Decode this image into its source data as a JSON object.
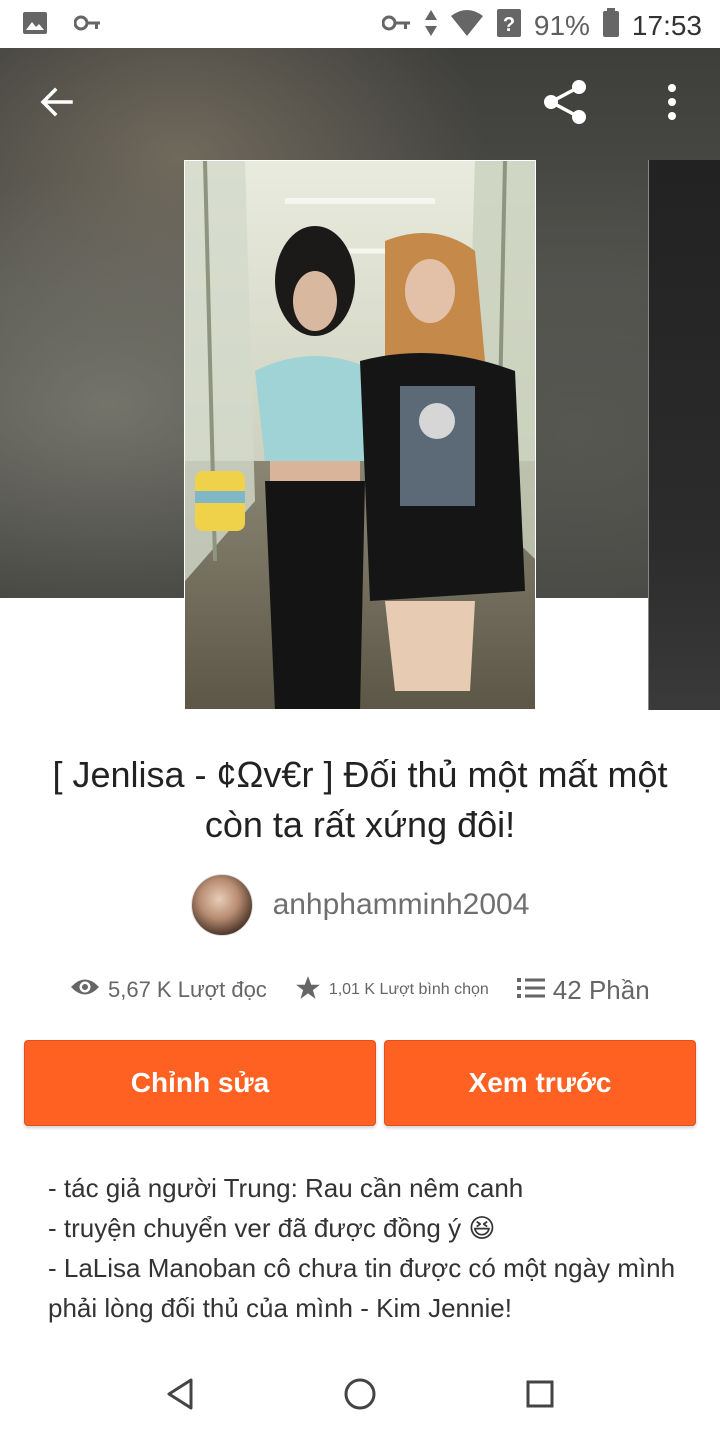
{
  "status_bar": {
    "battery": "91%",
    "time": "17:53",
    "icons": [
      "image-icon",
      "key-icon",
      "data-arrows-icon",
      "wifi-icon",
      "signal-unknown-icon",
      "battery-icon"
    ]
  },
  "top_bar": {
    "icons": [
      "back-arrow-icon",
      "share-icon",
      "more-vertical-icon"
    ]
  },
  "story": {
    "title": "[ Jenlisa - ¢Ωv€r ]  Đối thủ một mất một còn ta rất xứng đôi!",
    "author": "anhphamminh2004",
    "stats": {
      "reads": "5,67 K Lượt đọc",
      "votes": "1,01 K Lượt bình chọn",
      "parts": "42 Phần"
    },
    "buttons": {
      "edit": "Chỉnh sửa",
      "preview": "Xem trước"
    },
    "description": [
      "- tác giả người Trung: Rau cần nêm canh",
      "- truyện chuyển ver đã được đồng ý 😆",
      "- LaLisa Manoban cô chưa tin được có một ngày mình phải lòng đối thủ của mình - Kim Jennie!"
    ]
  },
  "colors": {
    "accent": "#ff6122",
    "text": "#222222",
    "muted": "#666666"
  },
  "nav_bar": {
    "icons": [
      "nav-back-icon",
      "nav-home-icon",
      "nav-recents-icon"
    ]
  }
}
